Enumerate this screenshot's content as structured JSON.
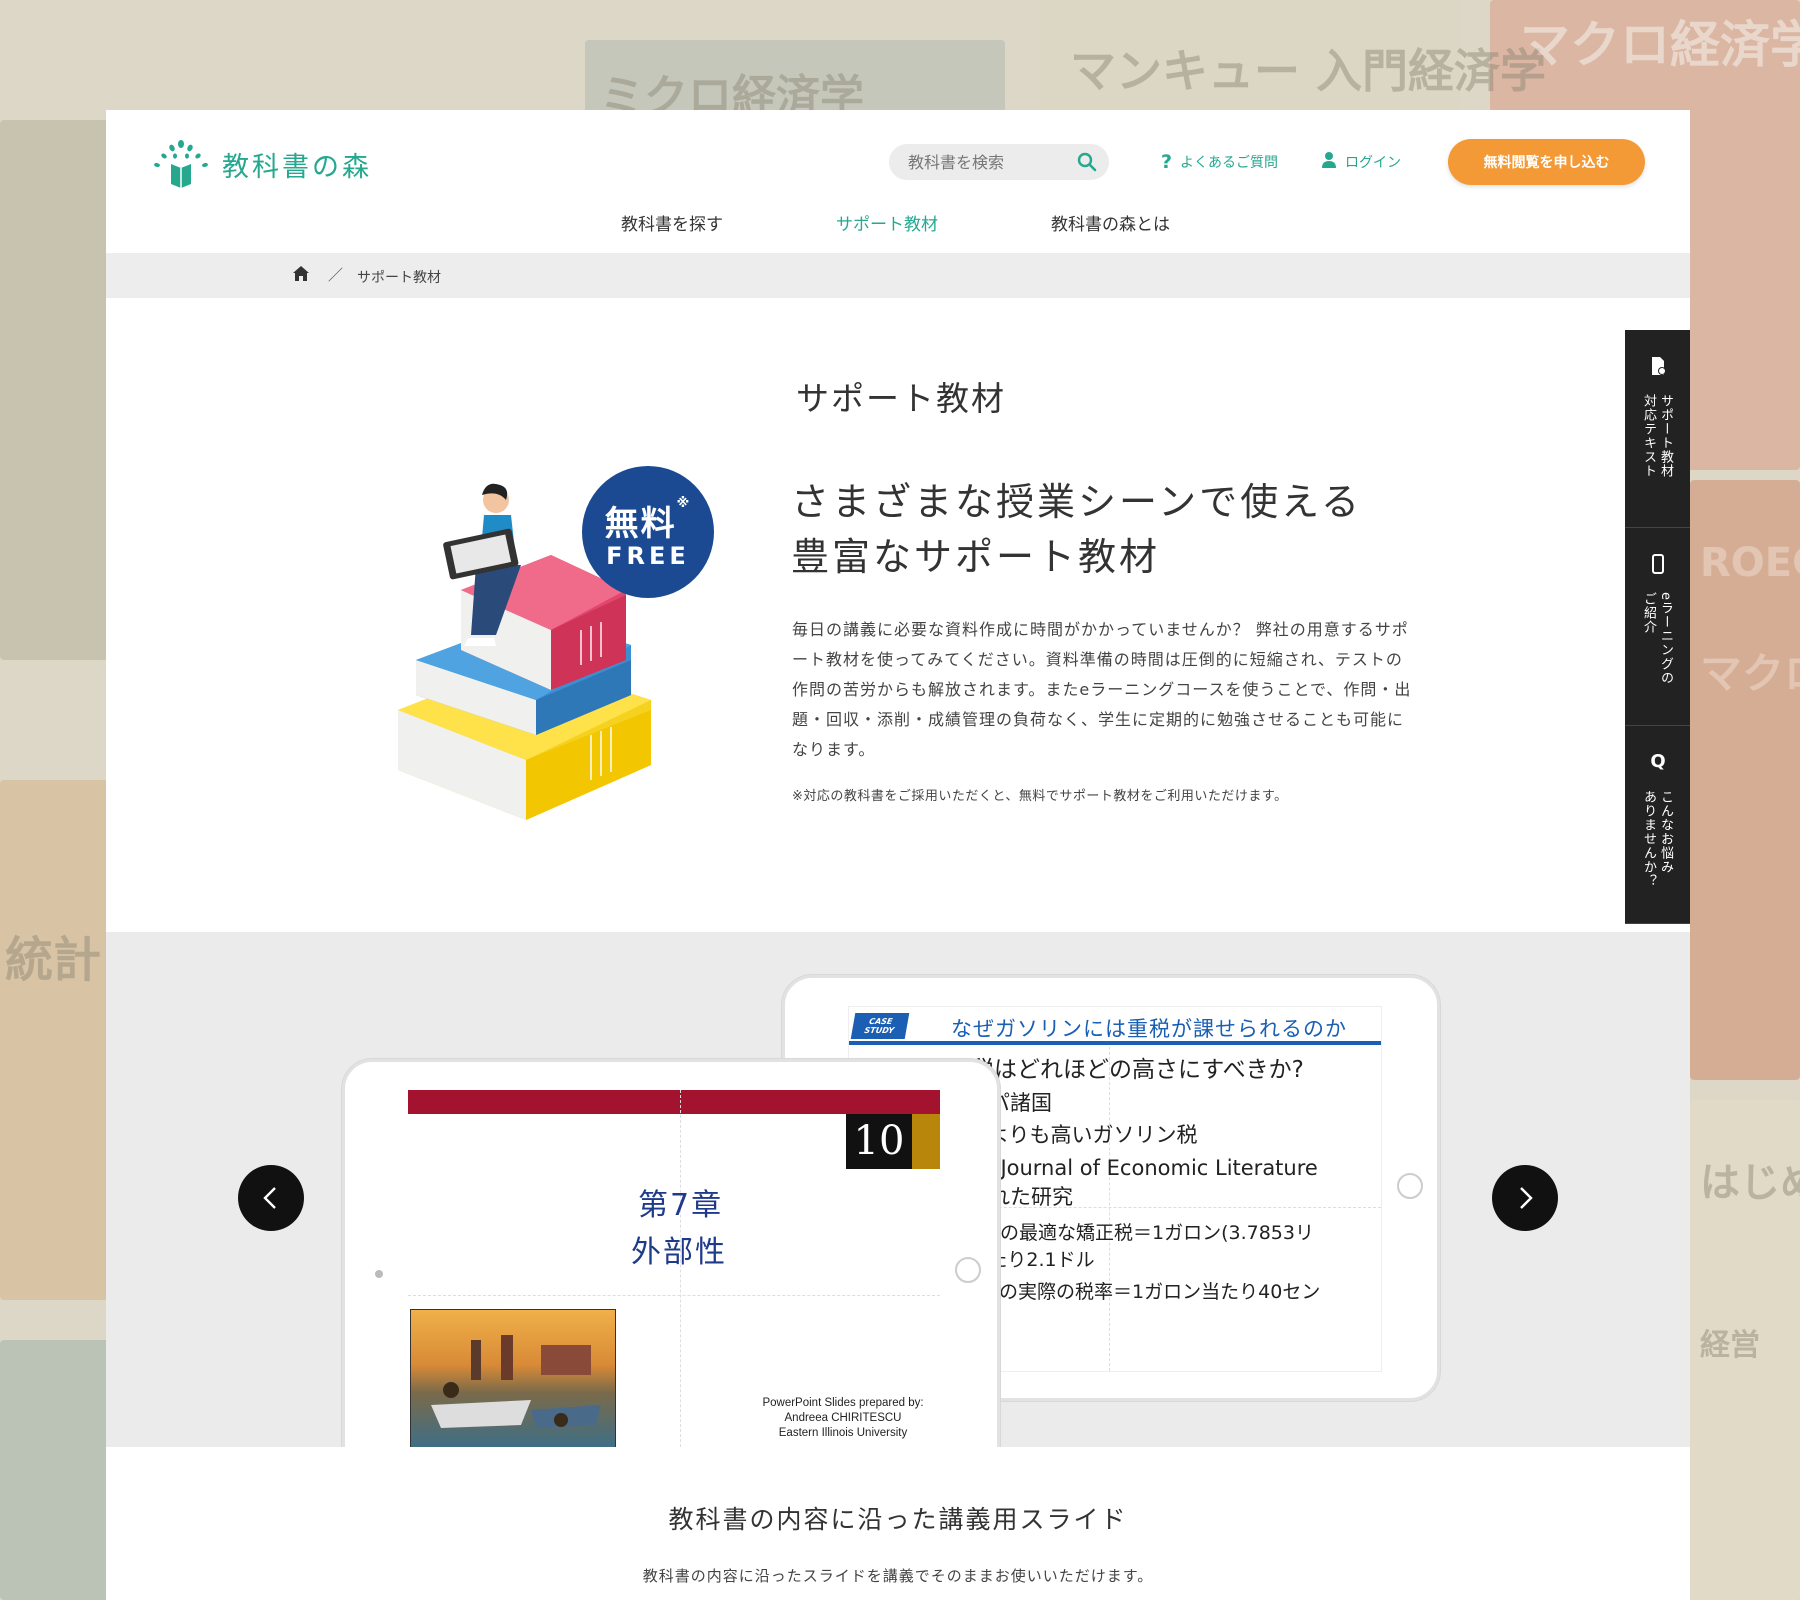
{
  "brand": {
    "name": "教科書の森",
    "color": "#26a88f",
    "cta_color": "#f39a36"
  },
  "header": {
    "search_placeholder": "教科書を検索",
    "faq_label": "よくあるご質問",
    "login_label": "ログイン",
    "cta_label": "無料閲覧を申し込む"
  },
  "nav": [
    {
      "label": "教科書を探す"
    },
    {
      "label": "サポート教材"
    },
    {
      "label": "教科書の森とは"
    }
  ],
  "breadcrumb": {
    "separator": "／",
    "current": "サポート教材"
  },
  "page": {
    "title": "サポート教材",
    "badge_main": "無料",
    "badge_mark": "※",
    "badge_sub": "FREE",
    "headline_1": "さまざまな授業シーンで使える",
    "headline_2": "豊富なサポート教材",
    "description": "毎日の講義に必要な資料作成に時間がかかっていませんか？ 弊社の用意するサポート教材を使ってみてください。資料準備の時間は圧倒的に短縮され、テストの作問の苦労からも解放されます。またeラーニングコースを使うことで、作問・出題・回収・添削・成績管理の負荷なく、学生に定期的に勉強させることも可能になります。",
    "note": "※対応の教科書をご採用いただくと、無料でサポート教材をご利用いただけます。"
  },
  "slides": {
    "back": {
      "badge": "CASE STUDY",
      "title": "なぜガソリンには重税が課せられるのか",
      "lines": [
        "ガソリン税はどれほどの高さにすべきか?",
        "ヨーロッパ諸国",
        "アメリカよりも高いガソリン税",
        "2007年のJournal of Economic Literature",
        "に掲載された研究",
        "ガソリンへの最適な矯正税＝1ガロン(3.7853リ",
        "ットル)当たり2.1ドル",
        "アメリカでの実際の税率＝1ガロン当たり40セン"
      ]
    },
    "front": {
      "number": "10",
      "chapter": "第7章",
      "chapter_title": "外部性",
      "credit_1": "PowerPoint Slides prepared by:",
      "credit_2": "Andreea CHIRITESCU",
      "credit_3": "Eastern Illinois University"
    }
  },
  "section2": {
    "title": "教科書の内容に沿った講義用スライド",
    "description": "教科書の内容に沿ったスライドを講義でそのままお使いいただけます。"
  },
  "side_tabs": [
    {
      "icon": "document-check-icon",
      "line1": "サポート教材",
      "line2": "対応テキスト"
    },
    {
      "icon": "smartphone-icon",
      "line1": "eラーニングの",
      "line2": "ご紹介"
    },
    {
      "icon": "q-icon",
      "glyph": "Q",
      "line1": "こんなお悩み",
      "line2": "ありませんか？"
    }
  ],
  "background_titles": [
    "ミクロ経済学",
    "マンキュー 入門経済学",
    "マクロ経済学",
    "統計",
    "経営",
    "マクロ",
    "ROECO",
    "はじめの"
  ]
}
